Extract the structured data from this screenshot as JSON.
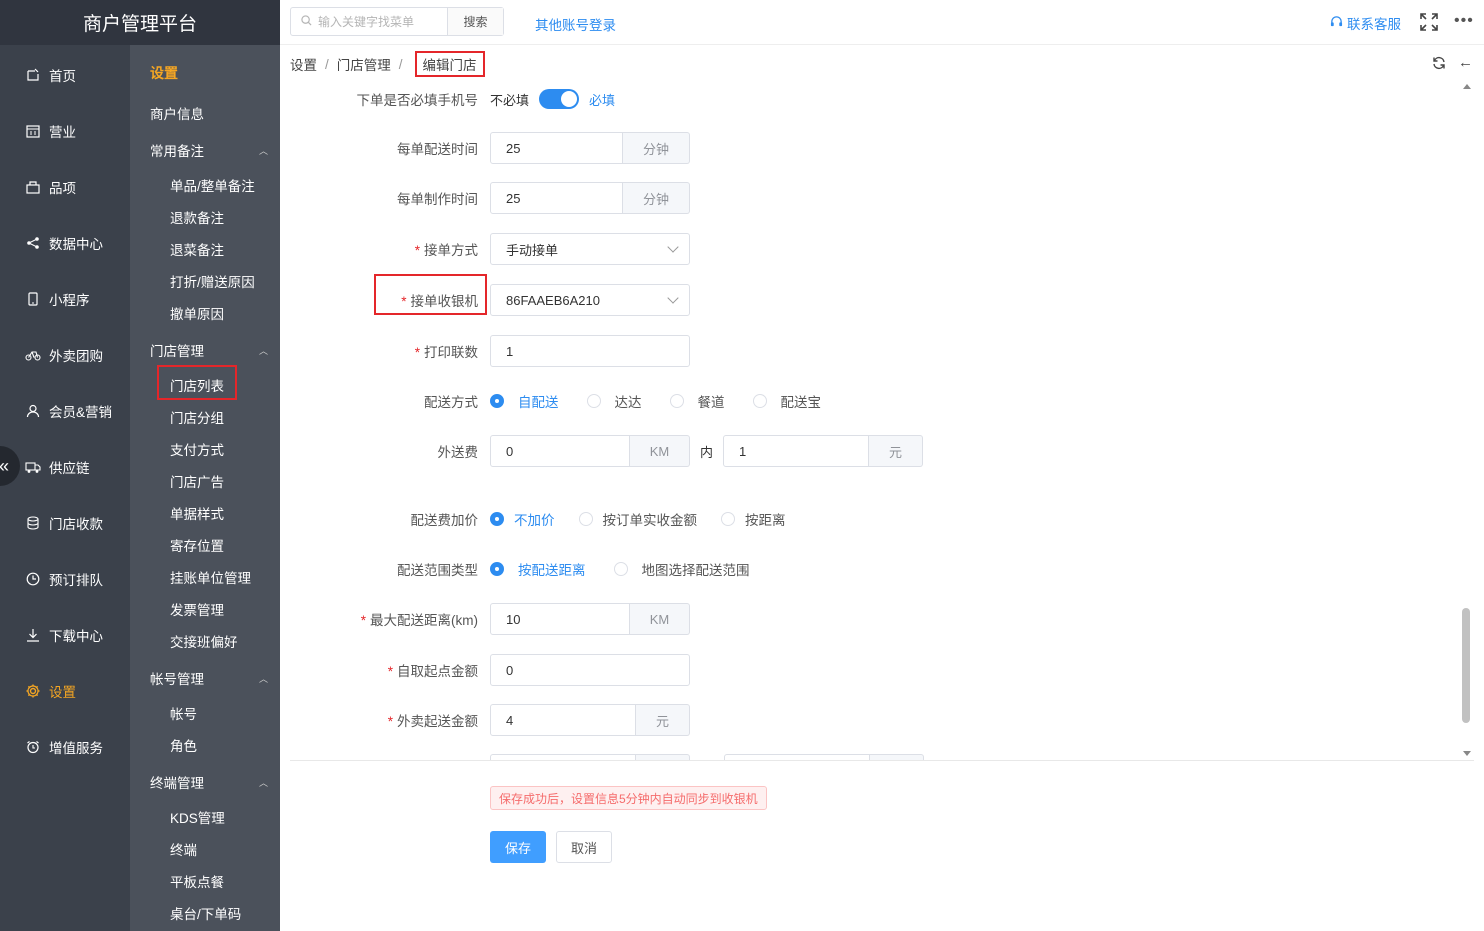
{
  "brand": "商户管理平台",
  "nav1": [
    {
      "label": "首页",
      "icon": "home-icon"
    },
    {
      "label": "营业",
      "icon": "calendar-icon"
    },
    {
      "label": "品项",
      "icon": "bag-icon"
    },
    {
      "label": "数据中心",
      "icon": "share-icon"
    },
    {
      "label": "小程序",
      "icon": "phone-icon"
    },
    {
      "label": "外卖团购",
      "icon": "bike-icon"
    },
    {
      "label": "会员&营销",
      "icon": "user-icon"
    },
    {
      "label": "供应链",
      "icon": "truck-icon"
    },
    {
      "label": "门店收款",
      "icon": "coins-icon"
    },
    {
      "label": "预订排队",
      "icon": "clock-icon"
    },
    {
      "label": "下载中心",
      "icon": "download-icon"
    },
    {
      "label": "设置",
      "icon": "gear-icon"
    },
    {
      "label": "增值服务",
      "icon": "alarm-icon"
    }
  ],
  "nav2": {
    "header": "设置",
    "merchant_info": "商户信息",
    "groups": {
      "remarks": {
        "label": "常用备注",
        "items": [
          "单品/整单备注",
          "退款备注",
          "退菜备注",
          "打折/赠送原因",
          "撤单原因"
        ]
      },
      "store": {
        "label": "门店管理",
        "items": [
          "门店列表",
          "门店分组",
          "支付方式",
          "门店广告",
          "单据样式",
          "寄存位置",
          "挂账单位管理",
          "发票管理",
          "交接班偏好"
        ]
      },
      "account": {
        "label": "帐号管理",
        "items": [
          "帐号",
          "角色"
        ]
      },
      "terminal": {
        "label": "终端管理",
        "items": [
          "KDS管理",
          "终端",
          "平板点餐",
          "桌台/下单码"
        ]
      }
    }
  },
  "topbar": {
    "search_placeholder": "输入关键字找菜单",
    "search_button": "搜索",
    "other_login": "其他账号登录",
    "contact": "联系客服"
  },
  "breadcrumb": [
    "设置",
    "门店管理",
    "编辑门店"
  ],
  "form": {
    "phone_required": {
      "label": "下单是否必填手机号",
      "off": "不必填",
      "on": "必填",
      "value": true
    },
    "delivery_time": {
      "label": "每单配送时间",
      "value": "25",
      "unit": "分钟"
    },
    "make_time": {
      "label": "每单制作时间",
      "value": "25",
      "unit": "分钟"
    },
    "accept_mode": {
      "label": "接单方式",
      "value": "手动接单"
    },
    "cashier": {
      "label": "接单收银机",
      "value": "86FAAEB6A210"
    },
    "print_copies": {
      "label": "打印联数",
      "value": "1"
    },
    "delivery_method": {
      "label": "配送方式",
      "options": [
        "自配送",
        "达达",
        "餐道",
        "配送宝"
      ],
      "selected": 0
    },
    "delivery_fee": {
      "label": "外送费",
      "distance": "0",
      "distance_unit": "KM",
      "within": "内",
      "fee": "1",
      "fee_unit": "元"
    },
    "fee_markup": {
      "label": "配送费加价",
      "options": [
        "不加价",
        "按订单实收金额",
        "按距离"
      ],
      "selected": 0
    },
    "range_type": {
      "label": "配送范围类型",
      "options": [
        "按配送距离",
        "地图选择配送范围"
      ],
      "selected": 0
    },
    "max_distance": {
      "label": "最大配送距离(km)",
      "value": "10",
      "unit": "KM"
    },
    "pickup_min": {
      "label": "自取起点金额",
      "value": "0"
    },
    "delivery_min": {
      "label": "外卖起送金额",
      "value": "4",
      "unit": "元"
    }
  },
  "footer": {
    "notice": "保存成功后，设置信息5分钟内自动同步到收银机",
    "save": "保存",
    "cancel": "取消"
  },
  "colors": {
    "accent": "#2d8cf0",
    "active_nav": "#f5a623",
    "highlight_box": "#e4262a"
  }
}
